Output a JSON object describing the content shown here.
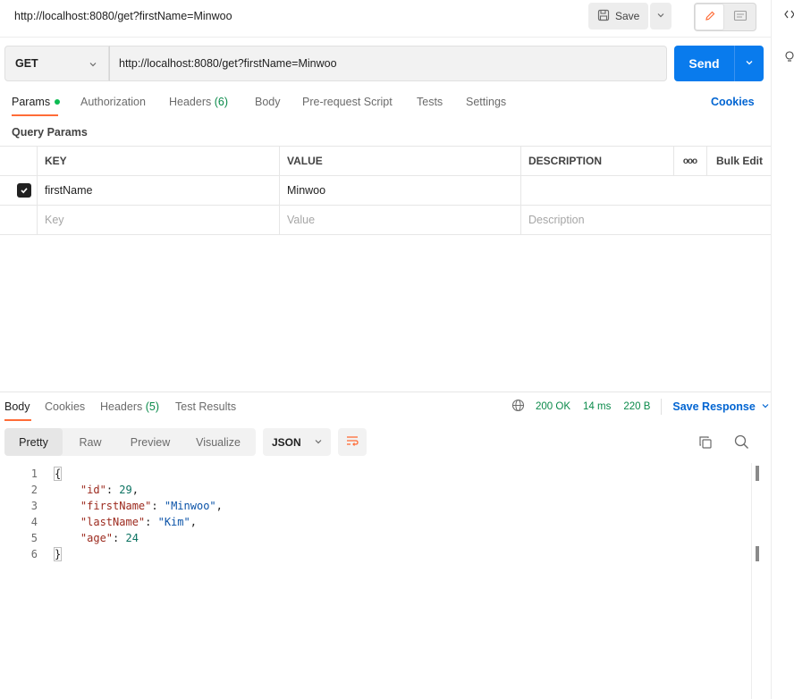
{
  "request": {
    "title": "http://localhost:8080/get?firstName=Minwoo",
    "method": "GET",
    "url": "http://localhost:8080/get?firstName=Minwoo",
    "save_label": "Save",
    "send_label": "Send"
  },
  "request_tabs": [
    {
      "label": "Params",
      "active": true,
      "has_dot": true
    },
    {
      "label": "Authorization"
    },
    {
      "label": "Headers",
      "count": "(6)"
    },
    {
      "label": "Body"
    },
    {
      "label": "Pre-request Script"
    },
    {
      "label": "Tests"
    },
    {
      "label": "Settings"
    }
  ],
  "cookies_link": "Cookies",
  "query_params": {
    "title": "Query Params",
    "headers": {
      "key": "KEY",
      "value": "VALUE",
      "description": "DESCRIPTION",
      "more": "ooo",
      "bulk_edit": "Bulk Edit"
    },
    "rows": [
      {
        "checked": true,
        "key": "firstName",
        "value": "Minwoo",
        "description": ""
      }
    ],
    "placeholders": {
      "key": "Key",
      "value": "Value",
      "description": "Description"
    }
  },
  "response_tabs": [
    {
      "label": "Body",
      "active": true
    },
    {
      "label": "Cookies"
    },
    {
      "label": "Headers",
      "count": "(5)"
    },
    {
      "label": "Test Results"
    }
  ],
  "response_status": {
    "status": "200 OK",
    "time": "14 ms",
    "size": "220 B",
    "save_response": "Save Response"
  },
  "view_modes": [
    "Pretty",
    "Raw",
    "Preview",
    "Visualize"
  ],
  "format": "JSON",
  "code_lines": [
    {
      "num": "1",
      "text": "{"
    },
    {
      "num": "2",
      "key": "\"id\"",
      "val": "29",
      "type": "n",
      "comma": ","
    },
    {
      "num": "3",
      "key": "\"firstName\"",
      "val": "\"Minwoo\"",
      "type": "s",
      "comma": ","
    },
    {
      "num": "4",
      "key": "\"lastName\"",
      "val": "\"Kim\"",
      "type": "s",
      "comma": ","
    },
    {
      "num": "5",
      "key": "\"age\"",
      "val": "24",
      "type": "n",
      "comma": ""
    },
    {
      "num": "6",
      "text": "}"
    }
  ],
  "colors": {
    "accent": "#ff6c37",
    "send": "#097bed",
    "link": "#0265d2",
    "status_ok": "#0a8a4a"
  }
}
